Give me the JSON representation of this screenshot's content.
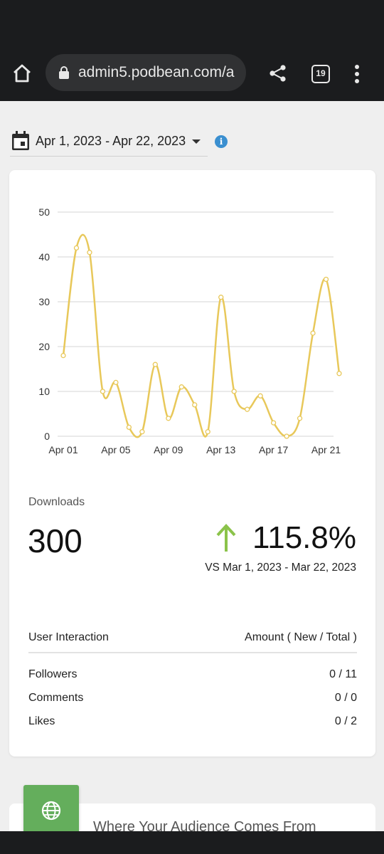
{
  "browser": {
    "url": "admin5.podbean.com/a",
    "tab_count": "19"
  },
  "filter": {
    "date_range": "Apr 1, 2023 - Apr 22, 2023",
    "info": "i"
  },
  "chart_data": {
    "type": "line",
    "x": [
      "Apr 01",
      "Apr 02",
      "Apr 03",
      "Apr 04",
      "Apr 05",
      "Apr 06",
      "Apr 07",
      "Apr 08",
      "Apr 09",
      "Apr 10",
      "Apr 11",
      "Apr 12",
      "Apr 13",
      "Apr 14",
      "Apr 15",
      "Apr 16",
      "Apr 17",
      "Apr 18",
      "Apr 19",
      "Apr 20",
      "Apr 21",
      "Apr 22"
    ],
    "xticks": [
      "Apr 01",
      "Apr 05",
      "Apr 09",
      "Apr 13",
      "Apr 17",
      "Apr 21"
    ],
    "series": [
      {
        "values": [
          18,
          42,
          41,
          10,
          12,
          2,
          1,
          16,
          4,
          11,
          7,
          1,
          31,
          10,
          6,
          9,
          3,
          0,
          4,
          23,
          35,
          14
        ]
      }
    ],
    "yticks": [
      0,
      10,
      20,
      30,
      40,
      50
    ],
    "ylim": [
      0,
      50
    ],
    "grid": true,
    "line_color": "#e8c85a"
  },
  "downloads": {
    "label": "Downloads",
    "total": "300",
    "change": "115.8%",
    "compare": "VS Mar 1, 2023 - Mar 22, 2023",
    "arrow_color": "#8bc34a"
  },
  "interaction": {
    "header_left": "User Interaction",
    "header_right": "Amount ( New / Total )",
    "rows": [
      {
        "name": "Followers",
        "value": "0 / 11"
      },
      {
        "name": "Comments",
        "value": "0 / 0"
      },
      {
        "name": "Likes",
        "value": "0 / 2"
      }
    ]
  },
  "audience": {
    "title": "Where Your Audience Comes From"
  }
}
